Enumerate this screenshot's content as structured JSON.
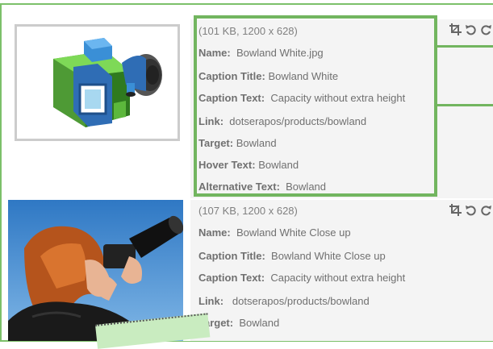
{
  "items": [
    {
      "meta": "(101 KB, 1200 x 628)",
      "name_label": "Name:",
      "name": "Bowland White.jpg",
      "caption_title_label": "Caption Title:",
      "caption_title": "Bowland White",
      "caption_text_label": "Caption Text:",
      "caption_text": "Capacity without extra height",
      "link_label": "Link:",
      "link": "dotserapos/products/bowland",
      "target_label": "Target:",
      "target": "Bowland",
      "hover_text_label": "Hover Text:",
      "hover_text": "Bowland",
      "alt_text_label": "Alternative Text:",
      "alt_text": "Bowland",
      "thumbnail_icon": "camera-illustration"
    },
    {
      "meta": "(107 KB, 1200 x 628)",
      "name_label": "Name:",
      "name": "Bowland White Close up",
      "caption_title_label": "Caption Title:",
      "caption_title": "Bowland White Close up",
      "caption_text_label": "Caption Text:",
      "caption_text": "Capacity without extra height",
      "link_label": "Link:",
      "link": "dotserapos/products/bowland",
      "target_label": "Target:",
      "target": "Bowland",
      "thumbnail_icon": "photographer-photo"
    }
  ],
  "tools": [
    "crop-icon",
    "rotate-left-icon",
    "rotate-right-icon"
  ],
  "colors": {
    "highlight": "#72b55f",
    "row_bg": "#f4f4f4",
    "text": "#707070"
  }
}
